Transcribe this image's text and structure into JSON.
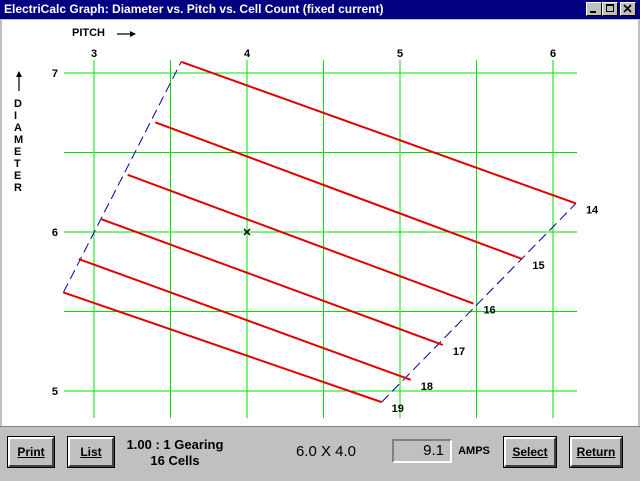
{
  "window": {
    "title": "ElectriCalc Graph:  Diameter vs. Pitch vs. Cell Count (fixed current)"
  },
  "axes": {
    "x_label": "PITCH",
    "y_label_letters": [
      "D",
      "I",
      "A",
      "M",
      "E",
      "T",
      "E",
      "R"
    ],
    "x_ticks": [
      "3",
      "4",
      "5",
      "6"
    ],
    "y_ticks": [
      "7",
      "6",
      "5"
    ]
  },
  "chart_data": {
    "type": "line",
    "title": "",
    "xlabel": "PITCH",
    "ylabel": "DIAMETER",
    "xlim": [
      2.95,
      6.2
    ],
    "ylim": [
      4.9,
      7.1
    ],
    "grid": true,
    "series": [
      {
        "name": "14",
        "x": [
          3.57,
          6.15
        ],
        "y": [
          7.07,
          6.18
        ]
      },
      {
        "name": "15",
        "x": [
          3.4,
          5.8
        ],
        "y": [
          6.69,
          5.83
        ]
      },
      {
        "name": "16",
        "x": [
          3.22,
          5.48
        ],
        "y": [
          6.36,
          5.55
        ]
      },
      {
        "name": "17",
        "x": [
          3.05,
          5.28
        ],
        "y": [
          6.08,
          5.29
        ]
      },
      {
        "name": "18",
        "x": [
          2.9,
          5.07
        ],
        "y": [
          5.83,
          5.07
        ]
      },
      {
        "name": "19",
        "x": [
          2.8,
          4.88
        ],
        "y": [
          5.62,
          4.93
        ]
      }
    ],
    "markers": [
      {
        "x": 4.0,
        "y": 6.0,
        "symbol": "x"
      }
    ],
    "boundaries": [
      {
        "x": [
          2.8,
          3.57
        ],
        "y": [
          5.62,
          7.07
        ]
      },
      {
        "x": [
          4.88,
          6.15
        ],
        "y": [
          4.93,
          6.18
        ]
      }
    ]
  },
  "bottom": {
    "print_label": "Print",
    "list_label": "List",
    "gearing": "1.00 : 1 Gearing",
    "cells": "16 Cells",
    "prop": "6.0 X 4.0",
    "amps_value": "9.1",
    "amps_unit": "AMPS",
    "select_label": "Select",
    "return_label": "Return"
  }
}
